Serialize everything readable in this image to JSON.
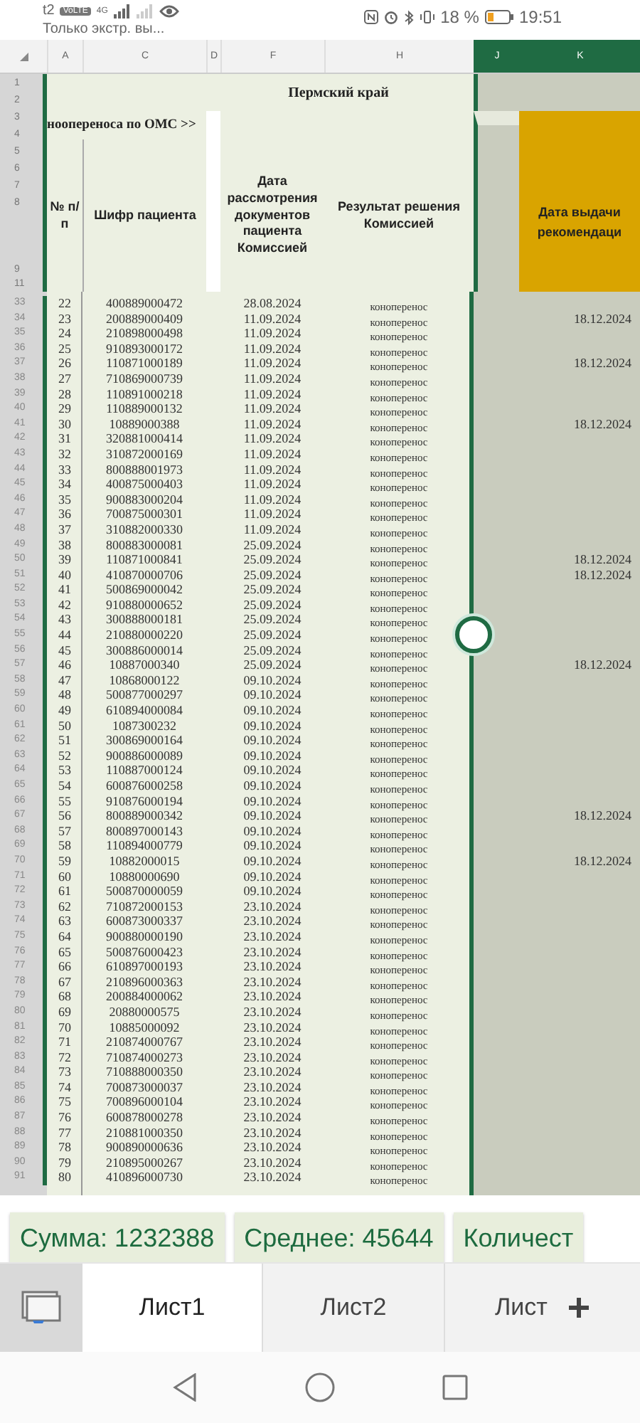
{
  "status_bar": {
    "carrier": "t2",
    "volte": "VoLTE",
    "notice": "Только экстр. вы...",
    "network": "4G",
    "battery": "18 %",
    "time": "19:51"
  },
  "column_headers": [
    {
      "label": "A",
      "selected": false
    },
    {
      "label": "C",
      "selected": false
    },
    {
      "label": "D",
      "selected": false
    },
    {
      "label": "F",
      "selected": false
    },
    {
      "label": "H",
      "selected": false
    },
    {
      "label": "J",
      "selected": true
    },
    {
      "label": "K",
      "selected": true
    }
  ],
  "header_rows": [
    "1",
    "2",
    "3",
    "4",
    "5",
    "6",
    "7",
    "8",
    "9",
    "11"
  ],
  "sheet_title": "Пермский край",
  "subtitle": "ноопереноса по ОМС >>",
  "table_headers": [
    "№ п/п",
    "Шифр пациента",
    "Дата рассмотрения документов пациента Комиссией",
    "Результат решения Комиссией",
    "Дата выдачи рекомендаци"
  ],
  "rows": [
    {
      "row": "33",
      "n": "22",
      "code": "400889000472",
      "date": "28.08.2024",
      "result": "коноперенос"
    },
    {
      "row": "34",
      "n": "23",
      "code": "200889000409",
      "date": "11.09.2024",
      "result": "коноперенос",
      "issued": "18.12.2024"
    },
    {
      "row": "35",
      "n": "24",
      "code": "210898000498",
      "date": "11.09.2024",
      "result": "коноперенос"
    },
    {
      "row": "36",
      "n": "25",
      "code": "910893000172",
      "date": "11.09.2024",
      "result": "коноперенос"
    },
    {
      "row": "37",
      "n": "26",
      "code": "110871000189",
      "date": "11.09.2024",
      "result": "коноперенос",
      "issued": "18.12.2024"
    },
    {
      "row": "38",
      "n": "27",
      "code": "710869000739",
      "date": "11.09.2024",
      "result": "коноперенос"
    },
    {
      "row": "39",
      "n": "28",
      "code": "110891000218",
      "date": "11.09.2024",
      "result": "коноперенос"
    },
    {
      "row": "40",
      "n": "29",
      "code": "110889000132",
      "date": "11.09.2024",
      "result": "коноперенос"
    },
    {
      "row": "41",
      "n": "30",
      "code": "10889000388",
      "date": "11.09.2024",
      "result": "коноперенос",
      "issued": "18.12.2024"
    },
    {
      "row": "42",
      "n": "31",
      "code": "320881000414",
      "date": "11.09.2024",
      "result": "коноперенос"
    },
    {
      "row": "43",
      "n": "32",
      "code": "310872000169",
      "date": "11.09.2024",
      "result": "коноперенос"
    },
    {
      "row": "44",
      "n": "33",
      "code": "800888001973",
      "date": "11.09.2024",
      "result": "коноперенос"
    },
    {
      "row": "45",
      "n": "34",
      "code": "400875000403",
      "date": "11.09.2024",
      "result": "коноперенос"
    },
    {
      "row": "46",
      "n": "35",
      "code": "900883000204",
      "date": "11.09.2024",
      "result": "коноперенос"
    },
    {
      "row": "47",
      "n": "36",
      "code": "700875000301",
      "date": "11.09.2024",
      "result": "коноперенос"
    },
    {
      "row": "48",
      "n": "37",
      "code": "310882000330",
      "date": "11.09.2024",
      "result": "коноперенос"
    },
    {
      "row": "49",
      "n": "38",
      "code": "800883000081",
      "date": "25.09.2024",
      "result": "коноперенос"
    },
    {
      "row": "50",
      "n": "39",
      "code": "110871000841",
      "date": "25.09.2024",
      "result": "коноперенос",
      "issued": "18.12.2024"
    },
    {
      "row": "51",
      "n": "40",
      "code": "410870000706",
      "date": "25.09.2024",
      "result": "коноперенос",
      "issued": "18.12.2024"
    },
    {
      "row": "52",
      "n": "41",
      "code": "500869000042",
      "date": "25.09.2024",
      "result": "коноперенос"
    },
    {
      "row": "53",
      "n": "42",
      "code": "910880000652",
      "date": "25.09.2024",
      "result": "коноперенос"
    },
    {
      "row": "54",
      "n": "43",
      "code": "300888000181",
      "date": "25.09.2024",
      "result": "коноперенос"
    },
    {
      "row": "55",
      "n": "44",
      "code": "210880000220",
      "date": "25.09.2024",
      "result": "коноперенос"
    },
    {
      "row": "56",
      "n": "45",
      "code": "300886000014",
      "date": "25.09.2024",
      "result": "коноперенос"
    },
    {
      "row": "57",
      "n": "46",
      "code": "10887000340",
      "date": "25.09.2024",
      "result": "коноперенос",
      "issued": "18.12.2024"
    },
    {
      "row": "58",
      "n": "47",
      "code": "10868000122",
      "date": "09.10.2024",
      "result": "коноперенос"
    },
    {
      "row": "59",
      "n": "48",
      "code": "500877000297",
      "date": "09.10.2024",
      "result": "коноперенос"
    },
    {
      "row": "60",
      "n": "49",
      "code": "610894000084",
      "date": "09.10.2024",
      "result": "коноперенос"
    },
    {
      "row": "61",
      "n": "50",
      "code": "1087300232",
      "date": "09.10.2024",
      "result": "коноперенос"
    },
    {
      "row": "62",
      "n": "51",
      "code": "300869000164",
      "date": "09.10.2024",
      "result": "коноперенос"
    },
    {
      "row": "63",
      "n": "52",
      "code": "900886000089",
      "date": "09.10.2024",
      "result": "коноперенос"
    },
    {
      "row": "64",
      "n": "53",
      "code": "110887000124",
      "date": "09.10.2024",
      "result": "коноперенос"
    },
    {
      "row": "65",
      "n": "54",
      "code": "600876000258",
      "date": "09.10.2024",
      "result": "коноперенос"
    },
    {
      "row": "66",
      "n": "55",
      "code": "910876000194",
      "date": "09.10.2024",
      "result": "коноперенос"
    },
    {
      "row": "67",
      "n": "56",
      "code": "800889000342",
      "date": "09.10.2024",
      "result": "коноперенос",
      "issued": "18.12.2024"
    },
    {
      "row": "68",
      "n": "57",
      "code": "800897000143",
      "date": "09.10.2024",
      "result": "коноперенос"
    },
    {
      "row": "69",
      "n": "58",
      "code": "110894000779",
      "date": "09.10.2024",
      "result": "коноперенос"
    },
    {
      "row": "70",
      "n": "59",
      "code": "10882000015",
      "date": "09.10.2024",
      "result": "коноперенос",
      "issued": "18.12.2024"
    },
    {
      "row": "71",
      "n": "60",
      "code": "10880000690",
      "date": "09.10.2024",
      "result": "коноперенос"
    },
    {
      "row": "72",
      "n": "61",
      "code": "500870000059",
      "date": "09.10.2024",
      "result": "коноперенос"
    },
    {
      "row": "73",
      "n": "62",
      "code": "710872000153",
      "date": "23.10.2024",
      "result": "коноперенос"
    },
    {
      "row": "74",
      "n": "63",
      "code": "600873000337",
      "date": "23.10.2024",
      "result": "коноперенос"
    },
    {
      "row": "75",
      "n": "64",
      "code": "900880000190",
      "date": "23.10.2024",
      "result": "коноперенос"
    },
    {
      "row": "76",
      "n": "65",
      "code": "500876000423",
      "date": "23.10.2024",
      "result": "коноперенос"
    },
    {
      "row": "77",
      "n": "66",
      "code": "610897000193",
      "date": "23.10.2024",
      "result": "коноперенос"
    },
    {
      "row": "78",
      "n": "67",
      "code": "210896000363",
      "date": "23.10.2024",
      "result": "коноперенос"
    },
    {
      "row": "79",
      "n": "68",
      "code": "200884000062",
      "date": "23.10.2024",
      "result": "коноперенос"
    },
    {
      "row": "80",
      "n": "69",
      "code": "20880000575",
      "date": "23.10.2024",
      "result": "коноперенос"
    },
    {
      "row": "81",
      "n": "70",
      "code": "10885000092",
      "date": "23.10.2024",
      "result": "коноперенос"
    },
    {
      "row": "82",
      "n": "71",
      "code": "210874000767",
      "date": "23.10.2024",
      "result": "коноперенос"
    },
    {
      "row": "83",
      "n": "72",
      "code": "710874000273",
      "date": "23.10.2024",
      "result": "коноперенос"
    },
    {
      "row": "84",
      "n": "73",
      "code": "710888000350",
      "date": "23.10.2024",
      "result": "коноперенос"
    },
    {
      "row": "85",
      "n": "74",
      "code": "700873000037",
      "date": "23.10.2024",
      "result": "коноперенос"
    },
    {
      "row": "86",
      "n": "75",
      "code": "700896000104",
      "date": "23.10.2024",
      "result": "коноперенос"
    },
    {
      "row": "87",
      "n": "76",
      "code": "600878000278",
      "date": "23.10.2024",
      "result": "коноперенос"
    },
    {
      "row": "88",
      "n": "77",
      "code": "210881000350",
      "date": "23.10.2024",
      "result": "коноперенос"
    },
    {
      "row": "89",
      "n": "78",
      "code": "900890000636",
      "date": "23.10.2024",
      "result": "коноперенос"
    },
    {
      "row": "90",
      "n": "79",
      "code": "210895000267",
      "date": "23.10.2024",
      "result": "коноперенос"
    },
    {
      "row": "91",
      "n": "80",
      "code": "410896000730",
      "date": "23.10.2024",
      "result": "коноперенос"
    }
  ],
  "summary": [
    "Сумма: 1232388",
    "Среднее: 45644",
    "Количест"
  ],
  "sheets": [
    {
      "label": "Лист1",
      "selected": true
    },
    {
      "label": "Лист2",
      "selected": false
    },
    {
      "label": "Лист",
      "selected": false
    }
  ]
}
